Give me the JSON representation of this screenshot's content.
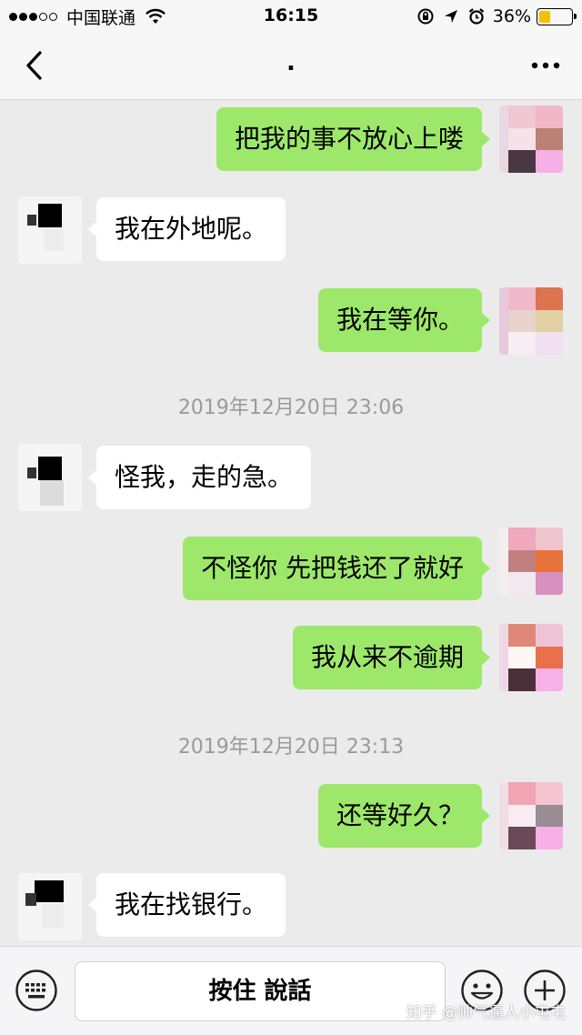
{
  "status_bar": {
    "carrier": "中国联通",
    "time": "16:15",
    "battery": "36%",
    "battery_level": 0.36,
    "signal_icon": "signal-dots-icon",
    "wifi_icon": "wifi-icon"
  },
  "nav": {
    "title": ".",
    "back_icon": "chevron-left-icon",
    "more_icon": "more-dots-icon"
  },
  "messages": [
    {
      "side": "right",
      "text": "把我的事不放心上喽"
    },
    {
      "side": "left",
      "text": "我在外地呢。"
    },
    {
      "side": "right",
      "text": "我在等你。"
    },
    {
      "side": "time",
      "text": "2019年12月20日 23:06"
    },
    {
      "side": "left",
      "text": "怪我，走的急。"
    },
    {
      "side": "right",
      "text": "不怪你 先把钱还了就好"
    },
    {
      "side": "right",
      "text": "我从来不逾期"
    },
    {
      "side": "time",
      "text": "2019年12月20日 23:13"
    },
    {
      "side": "right",
      "text": "还等好久？"
    },
    {
      "side": "left",
      "text": "我在找银行。"
    }
  ],
  "input_bar": {
    "hold_to_talk": "按住 說話",
    "keyboard_icon": "keyboard-icon",
    "emoji_icon": "emoji-icon",
    "plus_icon": "plus-icon"
  },
  "watermark": "知乎 @帅气逼人小屯屯",
  "colors": {
    "outgoing_bubble": "#9de86a",
    "incoming_bubble": "#ffffff",
    "chat_background": "#ebebeb",
    "battery_fill": "#f5c000"
  }
}
